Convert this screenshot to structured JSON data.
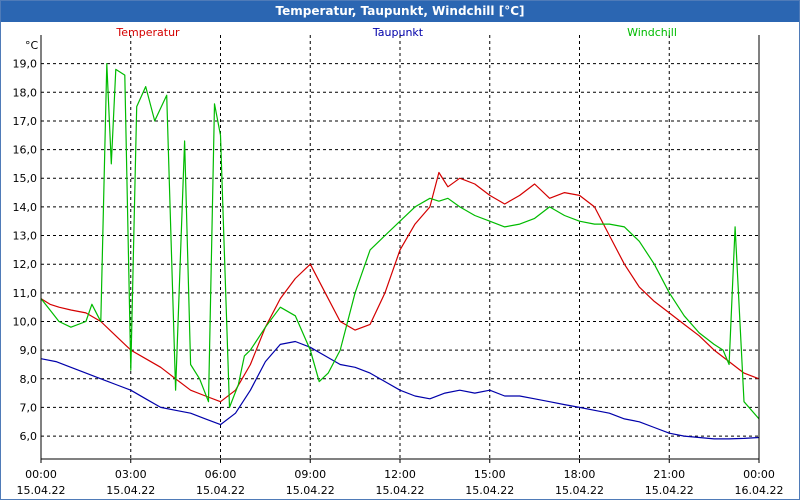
{
  "window": {
    "title": "Temperatur, Taupunkt, Windchill [°C]"
  },
  "chart_data": {
    "type": "line",
    "title": "Temperatur, Taupunkt, Windchill [°C]",
    "ylabel": "°C",
    "xlabel": "",
    "ylim": [
      5.2,
      20.0
    ],
    "xlim": [
      0,
      24
    ],
    "grid": true,
    "legend_position": "top",
    "y_ticks": [
      "6,0",
      "7,0",
      "8,0",
      "9,0",
      "10,0",
      "11,0",
      "12,0",
      "13,0",
      "14,0",
      "15,0",
      "16,0",
      "17,0",
      "18,0",
      "19,0"
    ],
    "x_ticks": [
      {
        "time": "00:00",
        "date": "15.04.22"
      },
      {
        "time": "03:00",
        "date": "15.04.22"
      },
      {
        "time": "06:00",
        "date": "15.04.22"
      },
      {
        "time": "09:00",
        "date": "15.04.22"
      },
      {
        "time": "12:00",
        "date": "15.04.22"
      },
      {
        "time": "15:00",
        "date": "15.04.22"
      },
      {
        "time": "18:00",
        "date": "15.04.22"
      },
      {
        "time": "21:00",
        "date": "15.04.22"
      },
      {
        "time": "00:00",
        "date": "16.04.22"
      }
    ],
    "series": [
      {
        "name": "Temperatur",
        "color": "#d40000",
        "x": [
          0,
          0.3,
          0.6,
          1.0,
          1.5,
          2.0,
          2.5,
          3.0,
          3.5,
          4.0,
          4.5,
          5.0,
          5.5,
          6.0,
          6.5,
          7.0,
          7.5,
          8.0,
          8.5,
          9.0,
          9.5,
          10.0,
          10.5,
          11.0,
          11.5,
          12.0,
          12.5,
          13.0,
          13.3,
          13.6,
          14.0,
          14.5,
          15.0,
          15.5,
          16.0,
          16.5,
          17.0,
          17.5,
          18.0,
          18.5,
          19.0,
          19.5,
          20.0,
          20.5,
          21.0,
          21.5,
          22.0,
          22.5,
          23.0,
          23.5,
          24.0
        ],
        "y": [
          10.8,
          10.6,
          10.5,
          10.4,
          10.3,
          10.0,
          9.5,
          9.0,
          8.7,
          8.4,
          8.0,
          7.6,
          7.4,
          7.2,
          7.6,
          8.5,
          9.8,
          10.8,
          11.5,
          12.0,
          11.0,
          10.0,
          9.7,
          9.9,
          11.0,
          12.5,
          13.4,
          14.0,
          15.2,
          14.7,
          15.0,
          14.8,
          14.4,
          14.1,
          14.4,
          14.8,
          14.3,
          14.5,
          14.4,
          14.0,
          13.0,
          12.0,
          11.2,
          10.7,
          10.3,
          9.9,
          9.5,
          9.0,
          8.6,
          8.2,
          8.0
        ]
      },
      {
        "name": "Taupunkt",
        "color": "#0000aa",
        "x": [
          0,
          0.5,
          1.0,
          1.5,
          2.0,
          2.5,
          3.0,
          3.5,
          4.0,
          4.5,
          5.0,
          5.5,
          6.0,
          6.5,
          7.0,
          7.5,
          8.0,
          8.5,
          9.0,
          9.5,
          10.0,
          10.5,
          11.0,
          11.5,
          12.0,
          12.5,
          13.0,
          13.5,
          14.0,
          14.5,
          15.0,
          15.5,
          16.0,
          16.5,
          17.0,
          17.5,
          18.0,
          18.5,
          19.0,
          19.5,
          20.0,
          20.5,
          21.0,
          21.5,
          22.0,
          22.5,
          23.0,
          23.5,
          24.0
        ],
        "y": [
          8.7,
          8.6,
          8.4,
          8.2,
          8.0,
          7.8,
          7.6,
          7.3,
          7.0,
          6.9,
          6.8,
          6.6,
          6.4,
          6.8,
          7.6,
          8.6,
          9.2,
          9.3,
          9.1,
          8.8,
          8.5,
          8.4,
          8.2,
          7.9,
          7.6,
          7.4,
          7.3,
          7.5,
          7.6,
          7.5,
          7.6,
          7.4,
          7.4,
          7.3,
          7.2,
          7.1,
          7.0,
          6.9,
          6.8,
          6.6,
          6.5,
          6.3,
          6.1,
          6.0,
          5.95,
          5.9,
          5.9,
          5.92,
          5.95
        ]
      },
      {
        "name": "Windchill",
        "color": "#00bb00",
        "x": [
          0,
          0.3,
          0.6,
          1.0,
          1.5,
          1.7,
          1.9,
          2.0,
          2.2,
          2.35,
          2.5,
          2.8,
          3.0,
          3.2,
          3.5,
          3.8,
          4.2,
          4.5,
          4.8,
          5.0,
          5.3,
          5.6,
          5.8,
          6.0,
          6.3,
          6.6,
          6.8,
          7.0,
          7.5,
          8.0,
          8.5,
          9.0,
          9.3,
          9.6,
          10.0,
          10.5,
          11.0,
          11.5,
          12.0,
          12.5,
          13.0,
          13.3,
          13.6,
          14.0,
          14.5,
          15.0,
          15.5,
          16.0,
          16.5,
          17.0,
          17.5,
          18.0,
          18.5,
          19.0,
          19.5,
          20.0,
          20.5,
          21.0,
          21.5,
          22.0,
          22.5,
          22.8,
          23.0,
          23.2,
          23.5,
          24.0
        ],
        "y": [
          10.8,
          10.4,
          10.0,
          9.8,
          10.0,
          10.6,
          10.2,
          10.0,
          19.0,
          15.5,
          18.8,
          18.6,
          8.3,
          17.5,
          18.2,
          17.0,
          17.9,
          7.6,
          16.3,
          8.5,
          8.0,
          7.2,
          17.6,
          16.5,
          7.0,
          7.8,
          8.8,
          9.0,
          9.8,
          10.5,
          10.2,
          9.0,
          7.9,
          8.2,
          9.0,
          11.0,
          12.5,
          13.0,
          13.5,
          14.0,
          14.3,
          14.2,
          14.3,
          14.0,
          13.7,
          13.5,
          13.3,
          13.4,
          13.6,
          14.0,
          13.7,
          13.5,
          13.4,
          13.4,
          13.3,
          12.8,
          12.0,
          11.0,
          10.2,
          9.6,
          9.2,
          9.0,
          8.5,
          13.3,
          7.2,
          6.6
        ]
      }
    ]
  }
}
